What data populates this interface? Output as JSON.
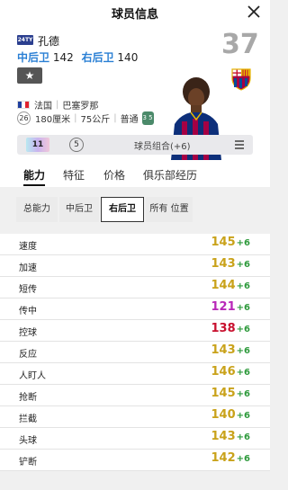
{
  "header": {
    "title": "球员信息"
  },
  "player": {
    "season_badge": "24TY",
    "name": "孔德",
    "positions": [
      {
        "pos": "中后卫",
        "value": "142"
      },
      {
        "pos": "右后卫",
        "value": "140"
      }
    ],
    "overall": "37",
    "star_label": "★",
    "nation": "法国",
    "club": "巴塞罗那",
    "age": "26",
    "height": "180厘米",
    "weight": "75公斤",
    "body_type": "普通",
    "skill_foot": "3 5"
  },
  "chemistry": {
    "upgrade": "11",
    "level": "5",
    "label": "球员组合(+6)"
  },
  "tabs": [
    "能力",
    "特征",
    "价格",
    "俱乐部经历"
  ],
  "subtabs": [
    "总能力",
    "中后卫",
    "右后卫",
    "所有 位置"
  ],
  "attributes": [
    {
      "name": "速度",
      "value": "145",
      "bonus": "+6",
      "color": "#c9a21a"
    },
    {
      "name": "加速",
      "value": "143",
      "bonus": "+6",
      "color": "#c9a21a"
    },
    {
      "name": "短传",
      "value": "144",
      "bonus": "+6",
      "color": "#c9a21a"
    },
    {
      "name": "传中",
      "value": "121",
      "bonus": "+6",
      "color": "#b827b8"
    },
    {
      "name": "控球",
      "value": "138",
      "bonus": "+6",
      "color": "#c8102e"
    },
    {
      "name": "反应",
      "value": "143",
      "bonus": "+6",
      "color": "#c9a21a"
    },
    {
      "name": "人盯人",
      "value": "146",
      "bonus": "+6",
      "color": "#c9a21a"
    },
    {
      "name": "抢断",
      "value": "145",
      "bonus": "+6",
      "color": "#c9a21a"
    },
    {
      "name": "拦截",
      "value": "140",
      "bonus": "+6",
      "color": "#c9a21a"
    },
    {
      "name": "头球",
      "value": "143",
      "bonus": "+6",
      "color": "#c9a21a"
    },
    {
      "name": "铲断",
      "value": "142",
      "bonus": "+6",
      "color": "#c9a21a"
    }
  ]
}
